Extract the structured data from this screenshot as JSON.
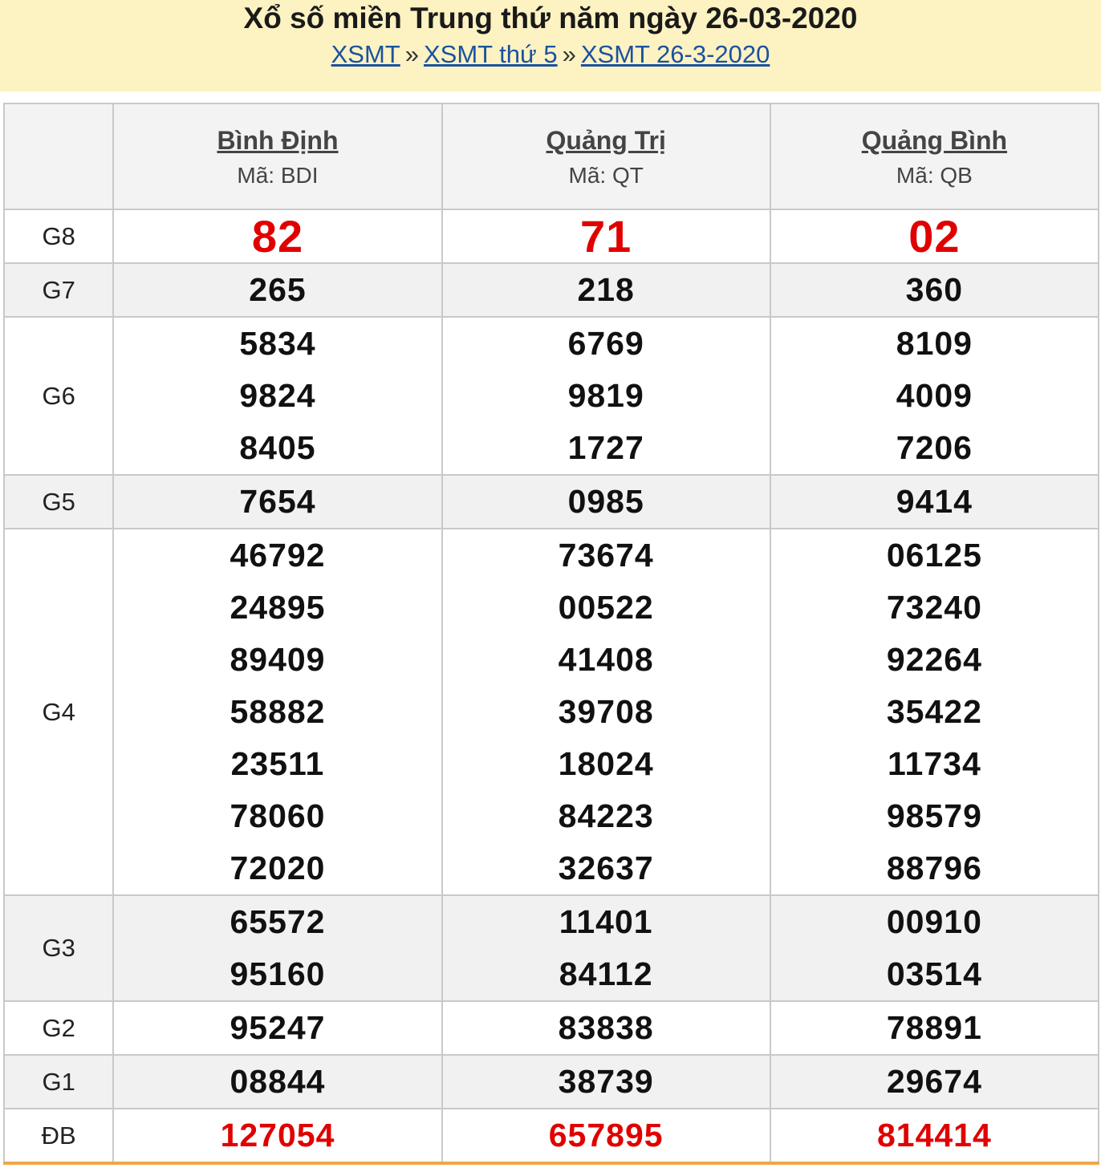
{
  "header": {
    "title": "Xổ số miền Trung thứ năm ngày 26-03-2020",
    "breadcrumb": [
      "XSMT",
      "XSMT thứ 5",
      "XSMT 26-3-2020"
    ],
    "separator": "»"
  },
  "provinces": [
    {
      "name": "Bình Định",
      "code": "Mã: BDI"
    },
    {
      "name": "Quảng Trị",
      "code": "Mã: QT"
    },
    {
      "name": "Quảng Bình",
      "code": "Mã: QB"
    }
  ],
  "prizes": [
    {
      "label": "G8",
      "values": [
        [
          "82"
        ],
        [
          "71"
        ],
        [
          "02"
        ]
      ]
    },
    {
      "label": "G7",
      "values": [
        [
          "265"
        ],
        [
          "218"
        ],
        [
          "360"
        ]
      ]
    },
    {
      "label": "G6",
      "values": [
        [
          "5834",
          "9824",
          "8405"
        ],
        [
          "6769",
          "9819",
          "1727"
        ],
        [
          "8109",
          "4009",
          "7206"
        ]
      ]
    },
    {
      "label": "G5",
      "values": [
        [
          "7654"
        ],
        [
          "0985"
        ],
        [
          "9414"
        ]
      ]
    },
    {
      "label": "G4",
      "values": [
        [
          "46792",
          "24895",
          "89409",
          "58882",
          "23511",
          "78060",
          "72020"
        ],
        [
          "73674",
          "00522",
          "41408",
          "39708",
          "18024",
          "84223",
          "32637"
        ],
        [
          "06125",
          "73240",
          "92264",
          "35422",
          "11734",
          "98579",
          "88796"
        ]
      ]
    },
    {
      "label": "G3",
      "values": [
        [
          "65572",
          "95160"
        ],
        [
          "11401",
          "84112"
        ],
        [
          "00910",
          "03514"
        ]
      ]
    },
    {
      "label": "G2",
      "values": [
        [
          "95247"
        ],
        [
          "83838"
        ],
        [
          "78891"
        ]
      ]
    },
    {
      "label": "G1",
      "values": [
        [
          "08844"
        ],
        [
          "38739"
        ],
        [
          "29674"
        ]
      ]
    },
    {
      "label": "ĐB",
      "values": [
        [
          "127054"
        ],
        [
          "657895"
        ],
        [
          "814414"
        ]
      ]
    }
  ],
  "colors": {
    "header_bg": "#fdf2c2",
    "highlight": "#e00000",
    "link": "#1a52a0"
  }
}
